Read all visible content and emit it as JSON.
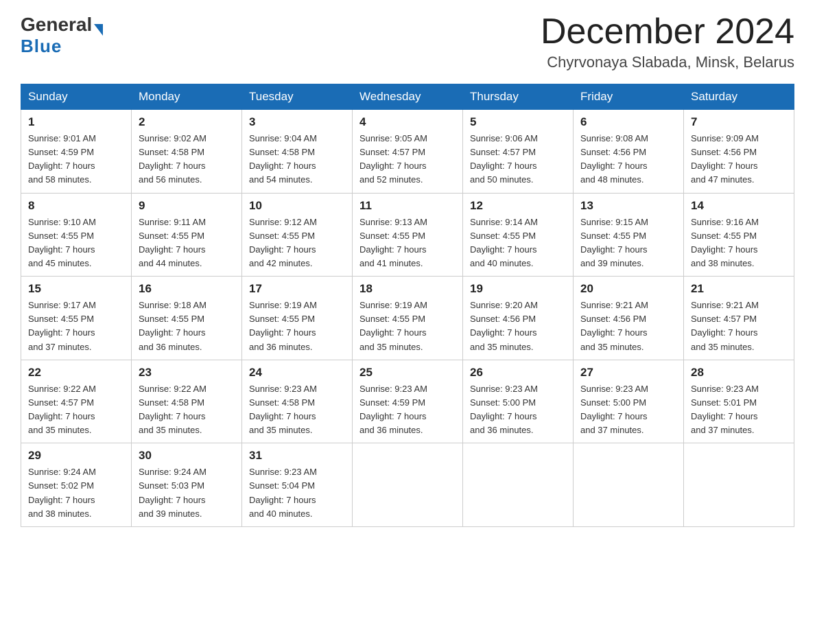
{
  "header": {
    "logo": {
      "general": "General",
      "blue": "Blue"
    },
    "title": "December 2024",
    "location": "Chyrvonaya Slabada, Minsk, Belarus"
  },
  "weekdays": [
    "Sunday",
    "Monday",
    "Tuesday",
    "Wednesday",
    "Thursday",
    "Friday",
    "Saturday"
  ],
  "weeks": [
    [
      {
        "day": "1",
        "sunrise": "9:01 AM",
        "sunset": "4:59 PM",
        "daylight_hours": "7 hours",
        "daylight_minutes": "and 58 minutes."
      },
      {
        "day": "2",
        "sunrise": "9:02 AM",
        "sunset": "4:58 PM",
        "daylight_hours": "7 hours",
        "daylight_minutes": "and 56 minutes."
      },
      {
        "day": "3",
        "sunrise": "9:04 AM",
        "sunset": "4:58 PM",
        "daylight_hours": "7 hours",
        "daylight_minutes": "and 54 minutes."
      },
      {
        "day": "4",
        "sunrise": "9:05 AM",
        "sunset": "4:57 PM",
        "daylight_hours": "7 hours",
        "daylight_minutes": "and 52 minutes."
      },
      {
        "day": "5",
        "sunrise": "9:06 AM",
        "sunset": "4:57 PM",
        "daylight_hours": "7 hours",
        "daylight_minutes": "and 50 minutes."
      },
      {
        "day": "6",
        "sunrise": "9:08 AM",
        "sunset": "4:56 PM",
        "daylight_hours": "7 hours",
        "daylight_minutes": "and 48 minutes."
      },
      {
        "day": "7",
        "sunrise": "9:09 AM",
        "sunset": "4:56 PM",
        "daylight_hours": "7 hours",
        "daylight_minutes": "and 47 minutes."
      }
    ],
    [
      {
        "day": "8",
        "sunrise": "9:10 AM",
        "sunset": "4:55 PM",
        "daylight_hours": "7 hours",
        "daylight_minutes": "and 45 minutes."
      },
      {
        "day": "9",
        "sunrise": "9:11 AM",
        "sunset": "4:55 PM",
        "daylight_hours": "7 hours",
        "daylight_minutes": "and 44 minutes."
      },
      {
        "day": "10",
        "sunrise": "9:12 AM",
        "sunset": "4:55 PM",
        "daylight_hours": "7 hours",
        "daylight_minutes": "and 42 minutes."
      },
      {
        "day": "11",
        "sunrise": "9:13 AM",
        "sunset": "4:55 PM",
        "daylight_hours": "7 hours",
        "daylight_minutes": "and 41 minutes."
      },
      {
        "day": "12",
        "sunrise": "9:14 AM",
        "sunset": "4:55 PM",
        "daylight_hours": "7 hours",
        "daylight_minutes": "and 40 minutes."
      },
      {
        "day": "13",
        "sunrise": "9:15 AM",
        "sunset": "4:55 PM",
        "daylight_hours": "7 hours",
        "daylight_minutes": "and 39 minutes."
      },
      {
        "day": "14",
        "sunrise": "9:16 AM",
        "sunset": "4:55 PM",
        "daylight_hours": "7 hours",
        "daylight_minutes": "and 38 minutes."
      }
    ],
    [
      {
        "day": "15",
        "sunrise": "9:17 AM",
        "sunset": "4:55 PM",
        "daylight_hours": "7 hours",
        "daylight_minutes": "and 37 minutes."
      },
      {
        "day": "16",
        "sunrise": "9:18 AM",
        "sunset": "4:55 PM",
        "daylight_hours": "7 hours",
        "daylight_minutes": "and 36 minutes."
      },
      {
        "day": "17",
        "sunrise": "9:19 AM",
        "sunset": "4:55 PM",
        "daylight_hours": "7 hours",
        "daylight_minutes": "and 36 minutes."
      },
      {
        "day": "18",
        "sunrise": "9:19 AM",
        "sunset": "4:55 PM",
        "daylight_hours": "7 hours",
        "daylight_minutes": "and 35 minutes."
      },
      {
        "day": "19",
        "sunrise": "9:20 AM",
        "sunset": "4:56 PM",
        "daylight_hours": "7 hours",
        "daylight_minutes": "and 35 minutes."
      },
      {
        "day": "20",
        "sunrise": "9:21 AM",
        "sunset": "4:56 PM",
        "daylight_hours": "7 hours",
        "daylight_minutes": "and 35 minutes."
      },
      {
        "day": "21",
        "sunrise": "9:21 AM",
        "sunset": "4:57 PM",
        "daylight_hours": "7 hours",
        "daylight_minutes": "and 35 minutes."
      }
    ],
    [
      {
        "day": "22",
        "sunrise": "9:22 AM",
        "sunset": "4:57 PM",
        "daylight_hours": "7 hours",
        "daylight_minutes": "and 35 minutes."
      },
      {
        "day": "23",
        "sunrise": "9:22 AM",
        "sunset": "4:58 PM",
        "daylight_hours": "7 hours",
        "daylight_minutes": "and 35 minutes."
      },
      {
        "day": "24",
        "sunrise": "9:23 AM",
        "sunset": "4:58 PM",
        "daylight_hours": "7 hours",
        "daylight_minutes": "and 35 minutes."
      },
      {
        "day": "25",
        "sunrise": "9:23 AM",
        "sunset": "4:59 PM",
        "daylight_hours": "7 hours",
        "daylight_minutes": "and 36 minutes."
      },
      {
        "day": "26",
        "sunrise": "9:23 AM",
        "sunset": "5:00 PM",
        "daylight_hours": "7 hours",
        "daylight_minutes": "and 36 minutes."
      },
      {
        "day": "27",
        "sunrise": "9:23 AM",
        "sunset": "5:00 PM",
        "daylight_hours": "7 hours",
        "daylight_minutes": "and 37 minutes."
      },
      {
        "day": "28",
        "sunrise": "9:23 AM",
        "sunset": "5:01 PM",
        "daylight_hours": "7 hours",
        "daylight_minutes": "and 37 minutes."
      }
    ],
    [
      {
        "day": "29",
        "sunrise": "9:24 AM",
        "sunset": "5:02 PM",
        "daylight_hours": "7 hours",
        "daylight_minutes": "and 38 minutes."
      },
      {
        "day": "30",
        "sunrise": "9:24 AM",
        "sunset": "5:03 PM",
        "daylight_hours": "7 hours",
        "daylight_minutes": "and 39 minutes."
      },
      {
        "day": "31",
        "sunrise": "9:23 AM",
        "sunset": "5:04 PM",
        "daylight_hours": "7 hours",
        "daylight_minutes": "and 40 minutes."
      },
      null,
      null,
      null,
      null
    ]
  ],
  "labels": {
    "sunrise": "Sunrise:",
    "sunset": "Sunset:",
    "daylight": "Daylight:"
  }
}
